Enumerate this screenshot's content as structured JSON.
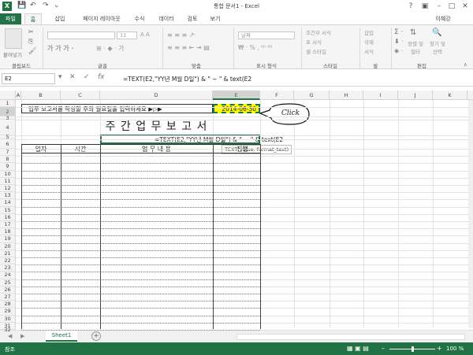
{
  "window": {
    "title": "통합 문서1 - Excel",
    "user": "이혜강"
  },
  "tabs": [
    "파일",
    "홈",
    "삽입",
    "페이지 레이아웃",
    "수식",
    "데이터",
    "검토",
    "보기"
  ],
  "ribbon": {
    "paste_label": "붙여넣기",
    "font_size": "11",
    "number_format": "날짜",
    "cond_format": "조건부 서식",
    "table_format": "표 서식",
    "cell_style": "셀 스타일",
    "insert": "삽입",
    "delete": "삭제",
    "format": "서식",
    "sort_filter": "정렬 및 필터",
    "find_select": "찾기 및 선택",
    "groups": [
      "클립보드",
      "글꼴",
      "맞춤",
      "표시 형식",
      "스타일",
      "셀",
      "편집"
    ]
  },
  "formula_bar": {
    "name_box": "E2",
    "fx": "fx",
    "formula": "=TEXT(E2,\"YY년 M월 D일\") & \" ~ \" & text(E2"
  },
  "columns": [
    "A",
    "B",
    "C",
    "D",
    "E",
    "F",
    "G",
    "H",
    "I",
    "J",
    "K"
  ],
  "rows": [
    "1",
    "2",
    "3",
    "4",
    "5",
    "6",
    "7",
    "8",
    "9",
    "10",
    "11",
    "12",
    "13",
    "14",
    "15",
    "16",
    "17",
    "18",
    "19",
    "20",
    "21",
    "22",
    "23",
    "24",
    "25",
    "26",
    "27",
    "28",
    "29",
    "30",
    "31",
    "32"
  ],
  "sheet": {
    "instruction": "업무 보고서를 작성할 주의 월요일을 입력하세요  ▶▷▶",
    "date_value": "2014-06-30",
    "title": "주 간 업 무 보 고 서",
    "cell_formula": "=TEXT(E2,\"YY년 M월 D일\") & \" ~ \" & text(E2",
    "tooltip": "TEXT(value, format_text)",
    "headers": [
      "일자",
      "시간",
      "업 무 내 용",
      "진행"
    ],
    "callout": "Click"
  },
  "sheet_tab": "Sheet1",
  "status": {
    "mode": "참조",
    "zoom": "100 %"
  },
  "colors": {
    "accent": "#217346",
    "date_fill": "#ffff00"
  }
}
